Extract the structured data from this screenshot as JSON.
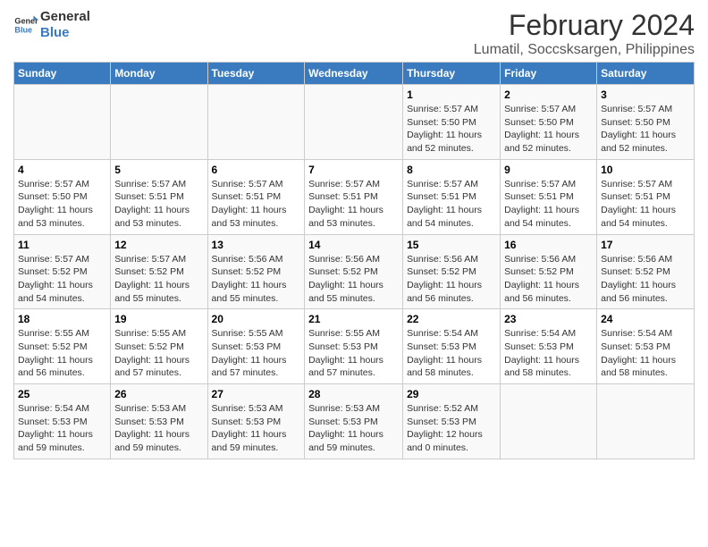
{
  "header": {
    "logo_line1": "General",
    "logo_line2": "Blue",
    "title": "February 2024",
    "subtitle": "Lumatil, Soccsksargen, Philippines"
  },
  "days_of_week": [
    "Sunday",
    "Monday",
    "Tuesday",
    "Wednesday",
    "Thursday",
    "Friday",
    "Saturday"
  ],
  "weeks": [
    [
      {
        "day": "",
        "info": ""
      },
      {
        "day": "",
        "info": ""
      },
      {
        "day": "",
        "info": ""
      },
      {
        "day": "",
        "info": ""
      },
      {
        "day": "1",
        "info": "Sunrise: 5:57 AM\nSunset: 5:50 PM\nDaylight: 11 hours\nand 52 minutes."
      },
      {
        "day": "2",
        "info": "Sunrise: 5:57 AM\nSunset: 5:50 PM\nDaylight: 11 hours\nand 52 minutes."
      },
      {
        "day": "3",
        "info": "Sunrise: 5:57 AM\nSunset: 5:50 PM\nDaylight: 11 hours\nand 52 minutes."
      }
    ],
    [
      {
        "day": "4",
        "info": "Sunrise: 5:57 AM\nSunset: 5:50 PM\nDaylight: 11 hours\nand 53 minutes."
      },
      {
        "day": "5",
        "info": "Sunrise: 5:57 AM\nSunset: 5:51 PM\nDaylight: 11 hours\nand 53 minutes."
      },
      {
        "day": "6",
        "info": "Sunrise: 5:57 AM\nSunset: 5:51 PM\nDaylight: 11 hours\nand 53 minutes."
      },
      {
        "day": "7",
        "info": "Sunrise: 5:57 AM\nSunset: 5:51 PM\nDaylight: 11 hours\nand 53 minutes."
      },
      {
        "day": "8",
        "info": "Sunrise: 5:57 AM\nSunset: 5:51 PM\nDaylight: 11 hours\nand 54 minutes."
      },
      {
        "day": "9",
        "info": "Sunrise: 5:57 AM\nSunset: 5:51 PM\nDaylight: 11 hours\nand 54 minutes."
      },
      {
        "day": "10",
        "info": "Sunrise: 5:57 AM\nSunset: 5:51 PM\nDaylight: 11 hours\nand 54 minutes."
      }
    ],
    [
      {
        "day": "11",
        "info": "Sunrise: 5:57 AM\nSunset: 5:52 PM\nDaylight: 11 hours\nand 54 minutes."
      },
      {
        "day": "12",
        "info": "Sunrise: 5:57 AM\nSunset: 5:52 PM\nDaylight: 11 hours\nand 55 minutes."
      },
      {
        "day": "13",
        "info": "Sunrise: 5:56 AM\nSunset: 5:52 PM\nDaylight: 11 hours\nand 55 minutes."
      },
      {
        "day": "14",
        "info": "Sunrise: 5:56 AM\nSunset: 5:52 PM\nDaylight: 11 hours\nand 55 minutes."
      },
      {
        "day": "15",
        "info": "Sunrise: 5:56 AM\nSunset: 5:52 PM\nDaylight: 11 hours\nand 56 minutes."
      },
      {
        "day": "16",
        "info": "Sunrise: 5:56 AM\nSunset: 5:52 PM\nDaylight: 11 hours\nand 56 minutes."
      },
      {
        "day": "17",
        "info": "Sunrise: 5:56 AM\nSunset: 5:52 PM\nDaylight: 11 hours\nand 56 minutes."
      }
    ],
    [
      {
        "day": "18",
        "info": "Sunrise: 5:55 AM\nSunset: 5:52 PM\nDaylight: 11 hours\nand 56 minutes."
      },
      {
        "day": "19",
        "info": "Sunrise: 5:55 AM\nSunset: 5:52 PM\nDaylight: 11 hours\nand 57 minutes."
      },
      {
        "day": "20",
        "info": "Sunrise: 5:55 AM\nSunset: 5:53 PM\nDaylight: 11 hours\nand 57 minutes."
      },
      {
        "day": "21",
        "info": "Sunrise: 5:55 AM\nSunset: 5:53 PM\nDaylight: 11 hours\nand 57 minutes."
      },
      {
        "day": "22",
        "info": "Sunrise: 5:54 AM\nSunset: 5:53 PM\nDaylight: 11 hours\nand 58 minutes."
      },
      {
        "day": "23",
        "info": "Sunrise: 5:54 AM\nSunset: 5:53 PM\nDaylight: 11 hours\nand 58 minutes."
      },
      {
        "day": "24",
        "info": "Sunrise: 5:54 AM\nSunset: 5:53 PM\nDaylight: 11 hours\nand 58 minutes."
      }
    ],
    [
      {
        "day": "25",
        "info": "Sunrise: 5:54 AM\nSunset: 5:53 PM\nDaylight: 11 hours\nand 59 minutes."
      },
      {
        "day": "26",
        "info": "Sunrise: 5:53 AM\nSunset: 5:53 PM\nDaylight: 11 hours\nand 59 minutes."
      },
      {
        "day": "27",
        "info": "Sunrise: 5:53 AM\nSunset: 5:53 PM\nDaylight: 11 hours\nand 59 minutes."
      },
      {
        "day": "28",
        "info": "Sunrise: 5:53 AM\nSunset: 5:53 PM\nDaylight: 11 hours\nand 59 minutes."
      },
      {
        "day": "29",
        "info": "Sunrise: 5:52 AM\nSunset: 5:53 PM\nDaylight: 12 hours\nand 0 minutes."
      },
      {
        "day": "",
        "info": ""
      },
      {
        "day": "",
        "info": ""
      }
    ]
  ]
}
